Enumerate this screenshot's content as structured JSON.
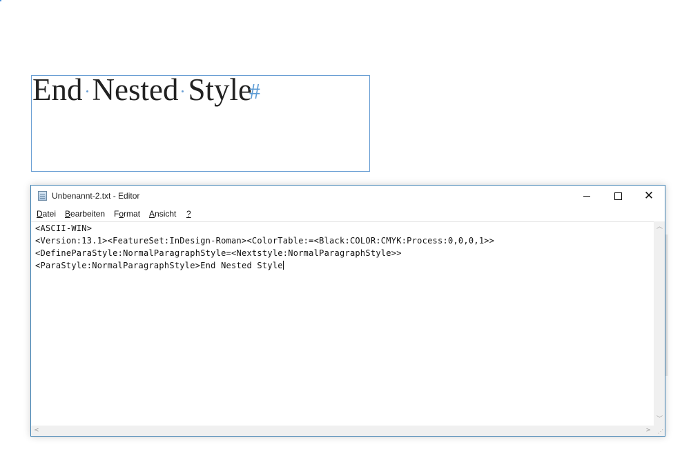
{
  "indesign_frame": {
    "words": [
      "End",
      "Nested",
      "Style"
    ],
    "end_marker": "#"
  },
  "notepad": {
    "title": "Unbenannt-2.txt - Editor",
    "menu": [
      {
        "underline": "D",
        "rest": "atei"
      },
      {
        "underline": "B",
        "rest": "earbeiten"
      },
      {
        "prefix": "F",
        "underline": "o",
        "rest": "rmat"
      },
      {
        "underline": "A",
        "rest": "nsicht"
      },
      {
        "underline": "?",
        "rest": ""
      }
    ],
    "lines": [
      "<ASCII-WIN>",
      "<Version:13.1><FeatureSet:InDesign-Roman><ColorTable:=<Black:COLOR:CMYK:Process:0,0,0,1>>",
      "<DefineParaStyle:NormalParagraphStyle=<Nextstyle:NormalParagraphStyle>>",
      "<ParaStyle:NormalParagraphStyle>End Nested Style"
    ],
    "window_buttons": {
      "minimize_icon": "minimize-icon",
      "maximize_icon": "maximize-icon",
      "close_icon": "close-icon"
    }
  },
  "colors": {
    "frame_border": "#6a9fd4",
    "window_border": "#3c7fb1",
    "end_marker": "#5b9bd5"
  }
}
